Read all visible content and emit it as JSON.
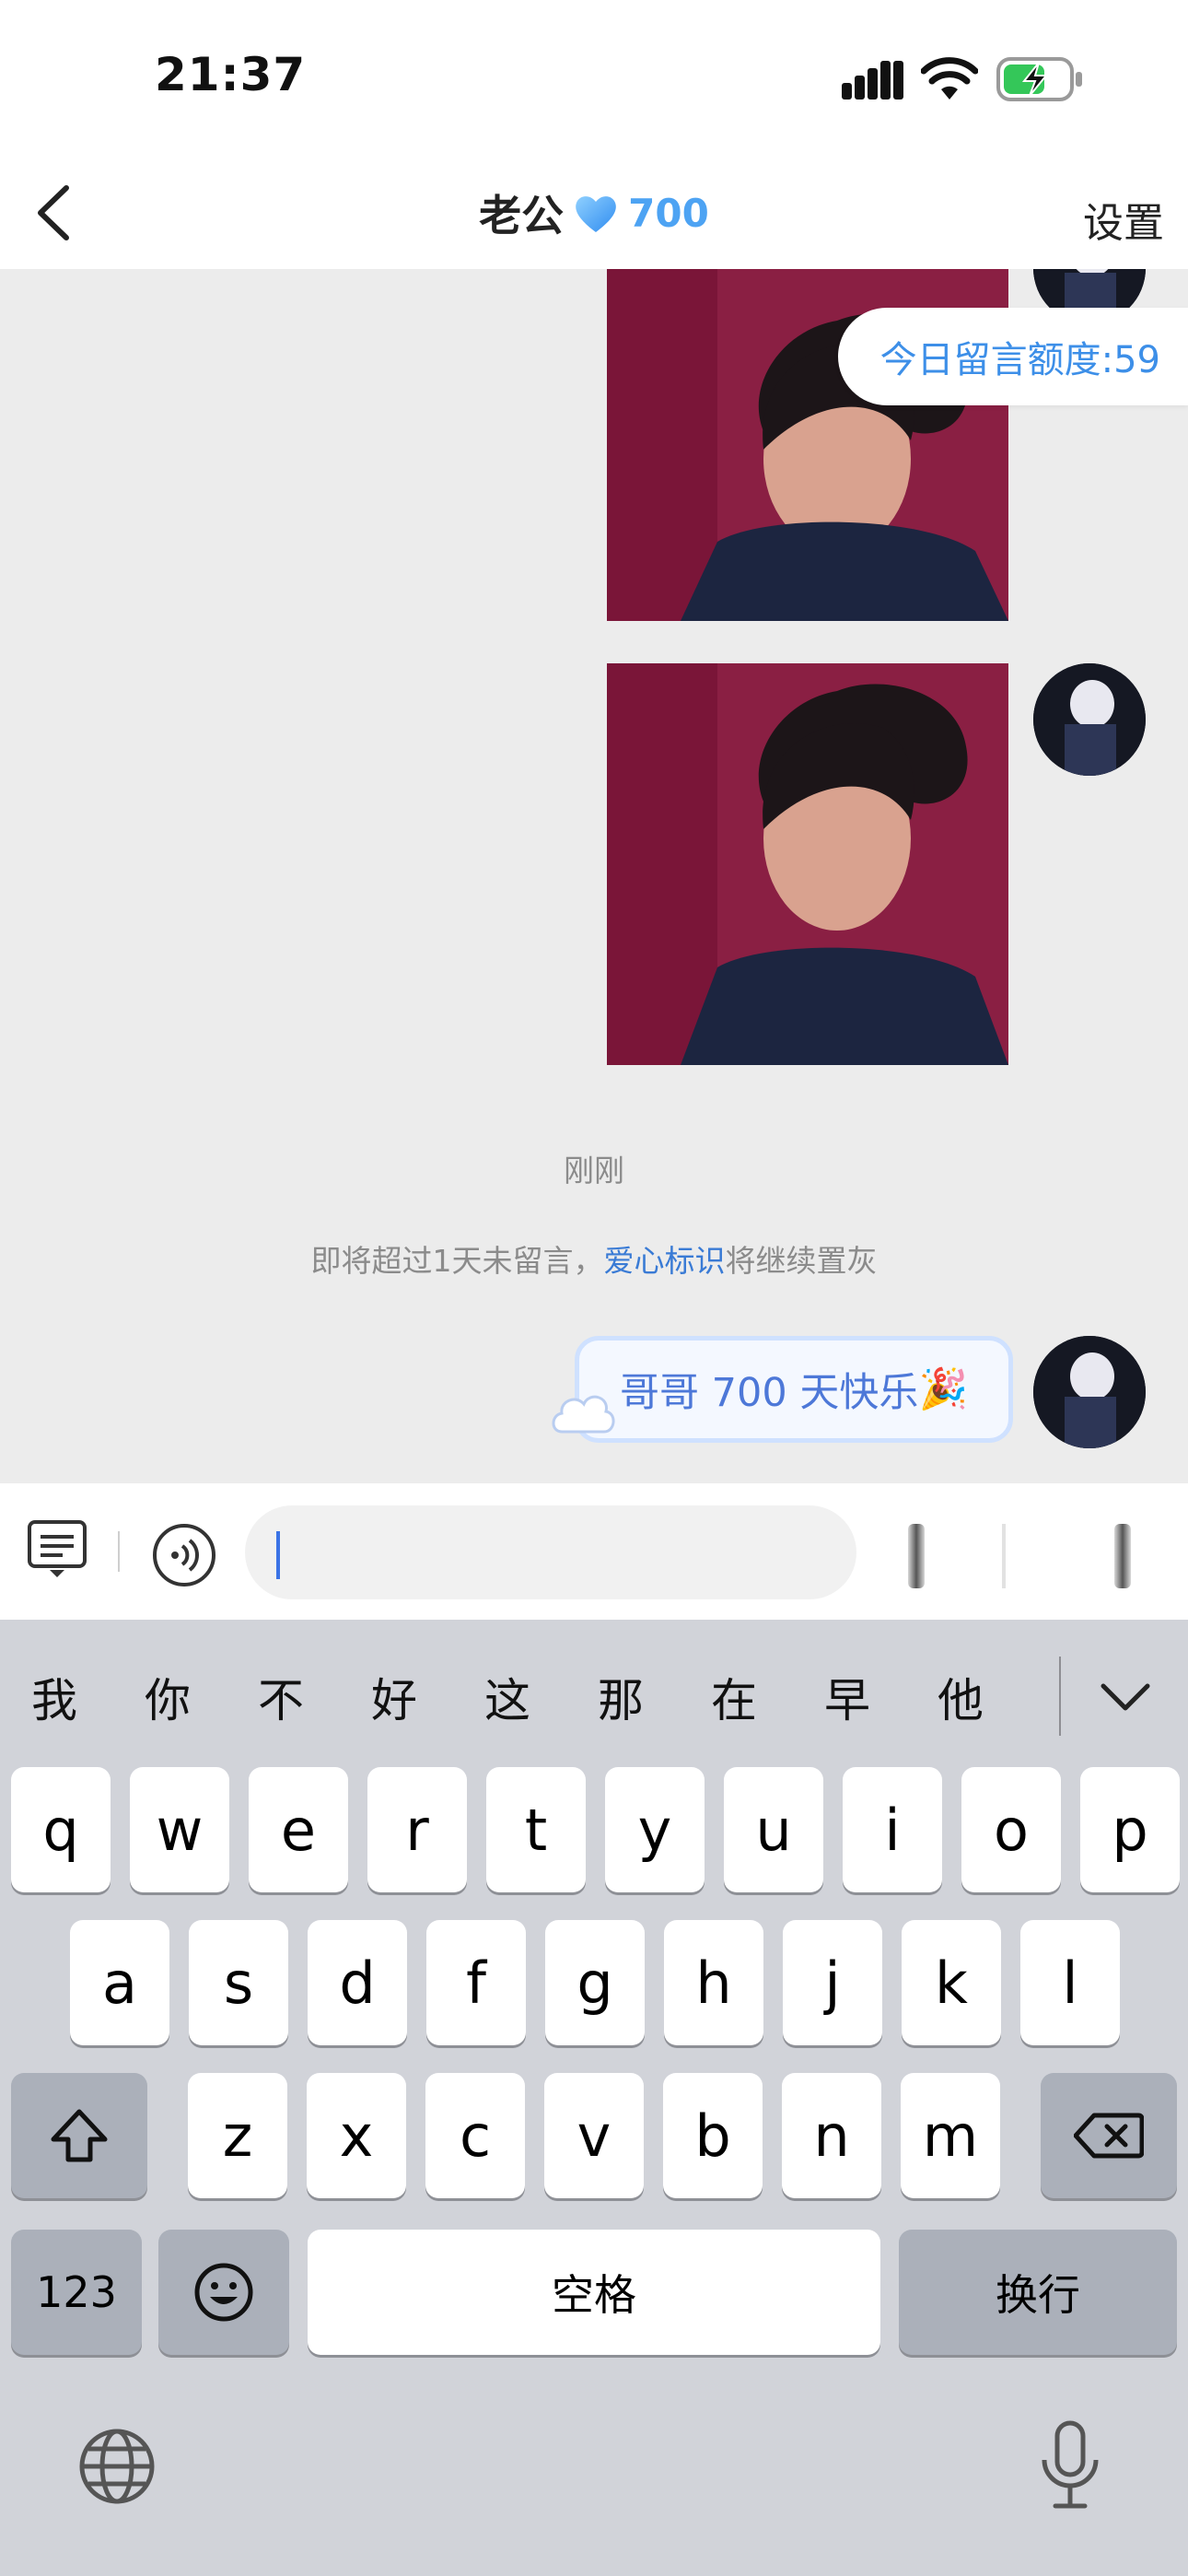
{
  "status_bar": {
    "time": "21:37"
  },
  "header": {
    "title": "老公",
    "heart_count": "700",
    "settings_label": "设置"
  },
  "chat": {
    "quota_label": "今日留言额度:59",
    "time_label": "刚刚",
    "notice_before": "即将超过1天未留言，",
    "notice_link": "爱心标识",
    "notice_after": "将继续置灰",
    "message_text": "哥哥 700 天快乐",
    "message_emoji": "🎉"
  },
  "input": {
    "placeholder": ""
  },
  "keyboard": {
    "candidates": [
      "我",
      "你",
      "不",
      "好",
      "这",
      "那",
      "在",
      "早",
      "他"
    ],
    "row1": [
      "q",
      "w",
      "e",
      "r",
      "t",
      "y",
      "u",
      "i",
      "o",
      "p"
    ],
    "row2": [
      "a",
      "s",
      "d",
      "f",
      "g",
      "h",
      "j",
      "k",
      "l"
    ],
    "row3": [
      "z",
      "x",
      "c",
      "v",
      "b",
      "n",
      "m"
    ],
    "numbers_label": "123",
    "space_label": "空格",
    "return_label": "换行"
  },
  "colors": {
    "accent": "#4da3f3",
    "link": "#3a7bd5",
    "photo_bg": "#8a1f43"
  }
}
